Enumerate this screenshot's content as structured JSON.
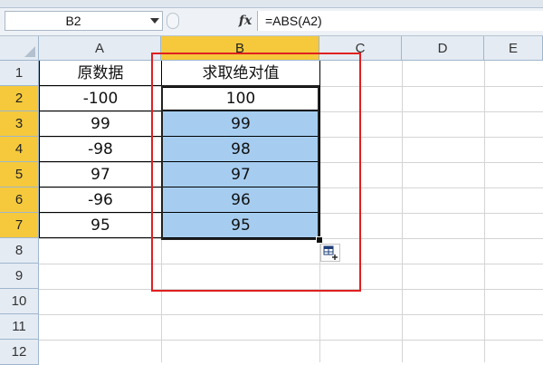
{
  "name_box": {
    "value": "B2"
  },
  "formula_bar": {
    "fx_icon": "function-icon",
    "formula": "=ABS(A2)"
  },
  "columns": [
    "A",
    "B",
    "C",
    "D",
    "E"
  ],
  "rows": [
    "1",
    "2",
    "3",
    "4",
    "5",
    "6",
    "7",
    "8",
    "9",
    "10",
    "11",
    "12"
  ],
  "table": {
    "headers": {
      "a": "原数据",
      "b": "求取绝对值"
    },
    "a_values": [
      "-100",
      "99",
      "-98",
      "97",
      "-96",
      "95"
    ],
    "b_values": [
      "100",
      "99",
      "98",
      "97",
      "96",
      "95"
    ]
  },
  "colors": {
    "active_header": "#f5c93b",
    "selection_fill": "#a6cdf0",
    "annotation": "#e02020"
  },
  "icons": {
    "corner": "select-all-triangle-icon",
    "autofill": "autofill-options-icon",
    "dropdown": "chevron-down-icon"
  }
}
